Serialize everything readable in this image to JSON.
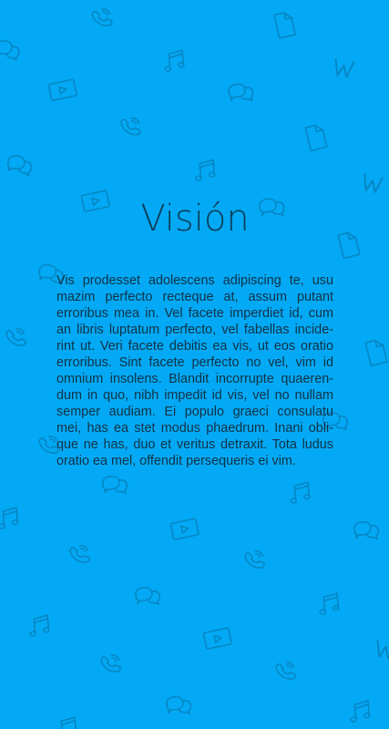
{
  "screen": {
    "background_color": "#03a9f4",
    "pattern_color": "#0b6a9e"
  },
  "vision": {
    "title": "Visión",
    "paragraph": "Vis prodesset adolescens adipiscing te, usu mazim perfecto recteque at, assum putant erroribus mea in. Vel facete imperdiet id, cum an libris luptatum perfecto, vel fabellas incide-rint ut. Veri facete debitis ea vis, ut eos oratio erroribus. Sint facete perfecto no vel, vim id omnium insolens. Blandit incorrupte quaeren-dum in quo, nibh impedit id vis, vel no nullam semper audiam. Ei populo graeci consulatu mei, has ea stet modus phaedrum. Inani obli-que ne has, duo et veritus detraxit. Tota ludus oratio ea mel, offendit persequeris ei vim."
  },
  "pattern_icons": [
    "phone-icon",
    "document-icon",
    "music-note-icon",
    "video-icon",
    "chat-bubbles-icon",
    "w-mark-icon"
  ]
}
